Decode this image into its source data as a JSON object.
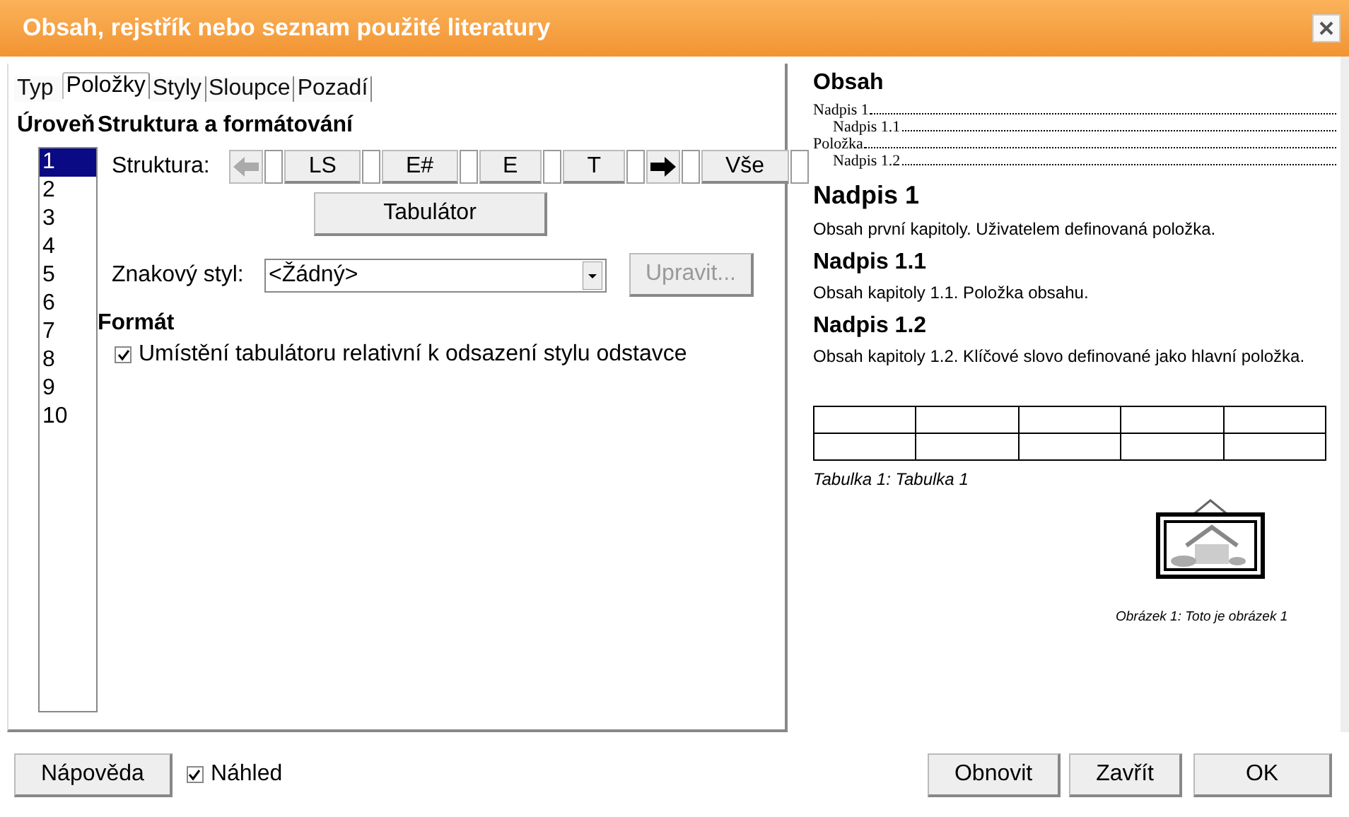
{
  "window": {
    "title": "Obsah, rejstřík nebo seznam použité literatury"
  },
  "tabs": [
    {
      "label": "Typ",
      "selected": false
    },
    {
      "label": "Položky",
      "selected": true
    },
    {
      "label": "Styly",
      "selected": false
    },
    {
      "label": "Sloupce",
      "selected": false
    },
    {
      "label": "Pozadí",
      "selected": false
    }
  ],
  "levels": {
    "title": "Úroveň",
    "items": [
      {
        "label": "1",
        "selected": true
      },
      {
        "label": "2",
        "selected": false
      },
      {
        "label": "3",
        "selected": false
      },
      {
        "label": "4",
        "selected": false
      },
      {
        "label": "5",
        "selected": false
      },
      {
        "label": "6",
        "selected": false
      },
      {
        "label": "7",
        "selected": false
      },
      {
        "label": "8",
        "selected": false
      },
      {
        "label": "9",
        "selected": false
      },
      {
        "label": "10",
        "selected": false
      }
    ]
  },
  "structure_section": {
    "title": "Struktura a formátování",
    "structure_label": "Struktura:",
    "structure": [
      {
        "kind": "arrow-left",
        "disabled": true
      },
      {
        "kind": "slot"
      },
      {
        "kind": "token",
        "label": "LS"
      },
      {
        "kind": "slot"
      },
      {
        "kind": "token",
        "label": "E#"
      },
      {
        "kind": "slot"
      },
      {
        "kind": "token",
        "label": "E"
      },
      {
        "kind": "slot"
      },
      {
        "kind": "token",
        "label": "T"
      },
      {
        "kind": "slot"
      },
      {
        "kind": "arrow-right",
        "disabled": false
      },
      {
        "kind": "slot"
      },
      {
        "kind": "token",
        "label": "Vše"
      },
      {
        "kind": "slot"
      }
    ],
    "tab_button": "Tabulátor",
    "char_style_label": "Znakový styl:",
    "char_style_value": "<Žádný>",
    "edit_button": {
      "label": "Upravit...",
      "disabled": true
    }
  },
  "format_section": {
    "title": "Formát",
    "checkbox": {
      "label": "Umístění tabulátoru relativní k odsazení stylu odstavce",
      "checked": true
    }
  },
  "preview": {
    "toc_title": "Obsah",
    "toc": [
      {
        "label": "Nadpis 1",
        "children": [
          {
            "label": "Nadpis 1.1"
          }
        ]
      },
      {
        "label": "Položka",
        "children": [
          {
            "label": "Nadpis 1.2"
          }
        ]
      }
    ],
    "sections": [
      {
        "heading": "Nadpis 1",
        "kind": "h1",
        "text": "Obsah první kapitoly. Uživatelem definovaná položka."
      },
      {
        "heading": "Nadpis 1.1",
        "kind": "h2",
        "text": "Obsah kapitoly 1.1. Položka obsahu."
      },
      {
        "heading": "Nadpis 1.2",
        "kind": "h2",
        "text": "Obsah kapitoly 1.2. Klíčové slovo definované jako hlavní položka."
      }
    ],
    "table_caption": "Tabulka 1: Tabulka 1",
    "image_caption": "Obrázek 1: Toto je obrázek 1"
  },
  "footer": {
    "help_button": "Nápověda",
    "preview_checkbox": {
      "label": "Náhled",
      "checked": true
    },
    "buttons": [
      "Obnovit",
      "Zavřít",
      "OK"
    ]
  }
}
